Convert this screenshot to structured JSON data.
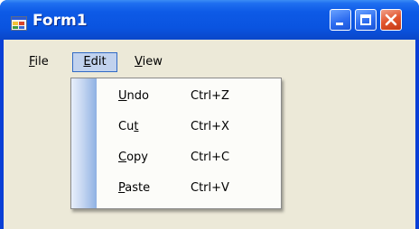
{
  "window": {
    "title": "Form1"
  },
  "caption_buttons": {
    "minimize": "minimize",
    "maximize": "maximize",
    "close": "close"
  },
  "colors": {
    "titlebar": "#0a54e0",
    "client": "#ece9d8",
    "menu_highlight": "#c1d2ee",
    "close_button": "#e2552e"
  },
  "menubar": {
    "items": [
      {
        "accel": "F",
        "rest": "ile"
      },
      {
        "accel": "E",
        "rest": "dit"
      },
      {
        "accel": "V",
        "rest": "iew"
      }
    ]
  },
  "edit_menu": {
    "items": [
      {
        "pre": "",
        "accel": "U",
        "post": "ndo",
        "shortcut": "Ctrl+Z"
      },
      {
        "pre": "Cu",
        "accel": "t",
        "post": "",
        "shortcut": "Ctrl+X"
      },
      {
        "pre": "",
        "accel": "C",
        "post": "opy",
        "shortcut": "Ctrl+C"
      },
      {
        "pre": "",
        "accel": "P",
        "post": "aste",
        "shortcut": "Ctrl+V"
      }
    ]
  },
  "icons": {
    "app": "form-app-icon",
    "minimize": "minimize-icon",
    "maximize": "maximize-icon",
    "close": "close-icon"
  }
}
